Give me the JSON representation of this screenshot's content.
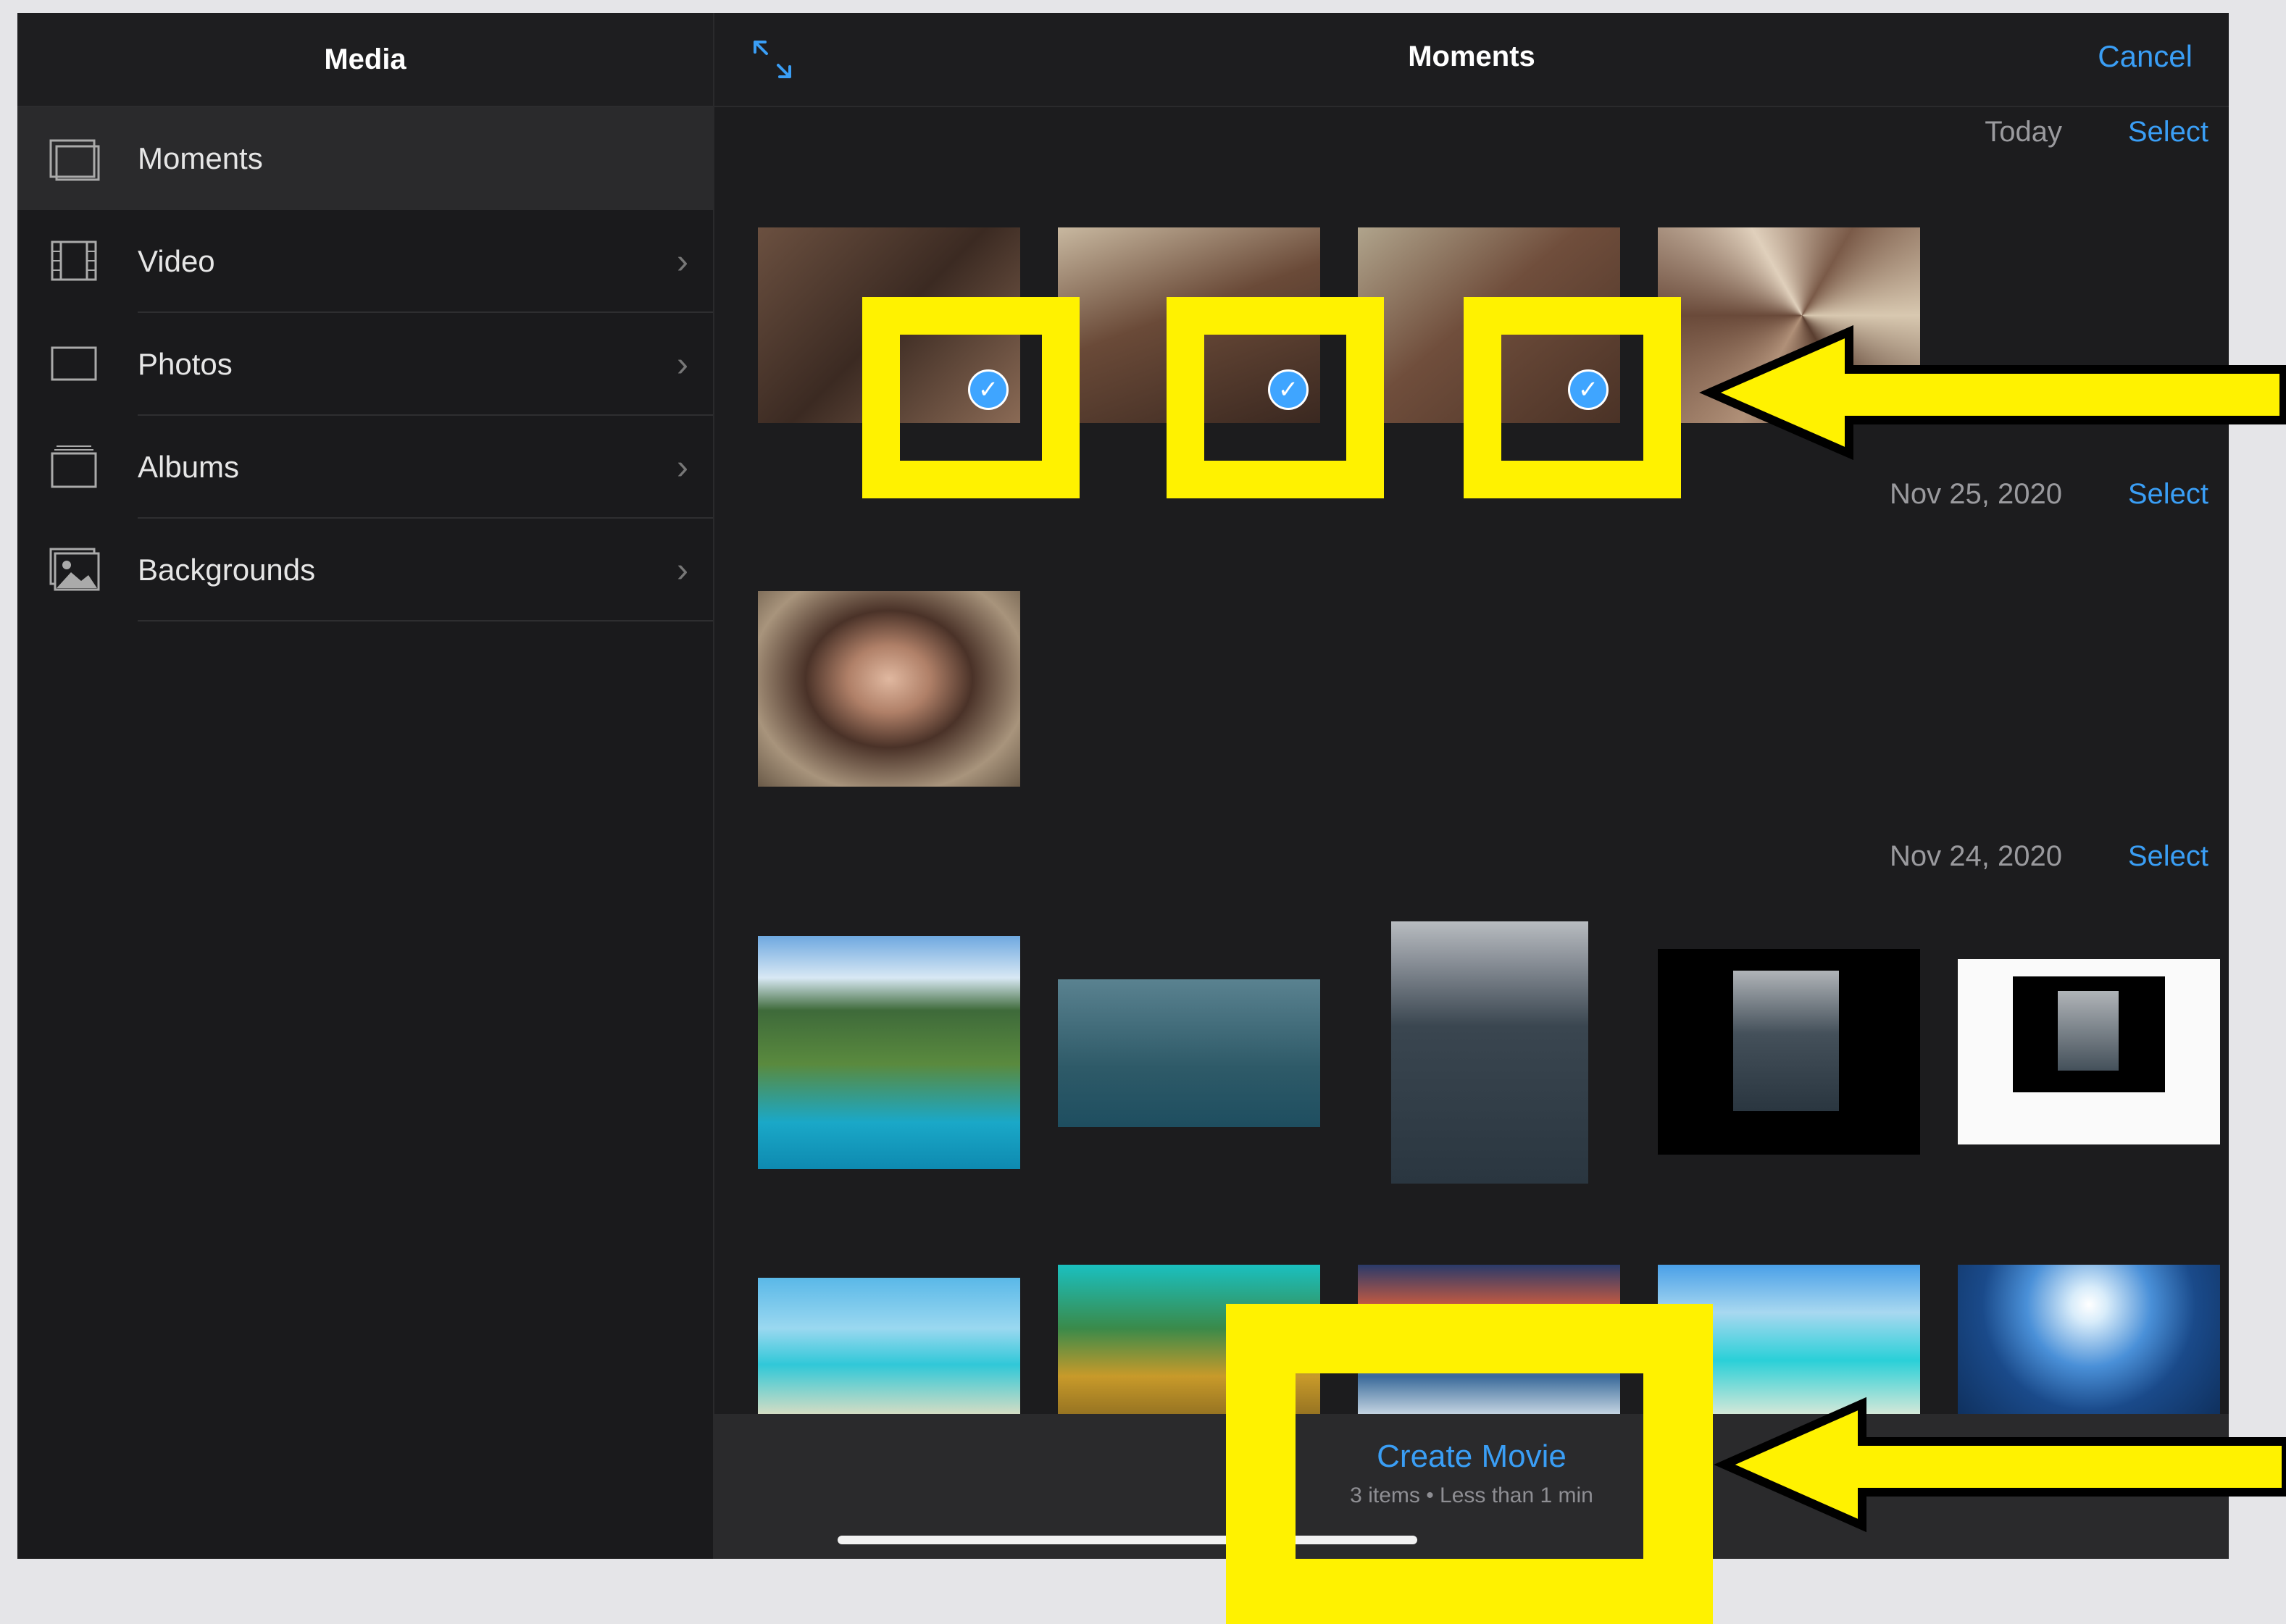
{
  "sidebar": {
    "title": "Media",
    "items": [
      {
        "label": "Moments",
        "icon": "stack-icon",
        "active": true
      },
      {
        "label": "Video",
        "icon": "film-icon"
      },
      {
        "label": "Photos",
        "icon": "photo-frame-icon"
      },
      {
        "label": "Albums",
        "icon": "album-stack-icon"
      },
      {
        "label": "Backgrounds",
        "icon": "landscape-image-icon"
      }
    ]
  },
  "header": {
    "title": "Moments",
    "cancel_label": "Cancel",
    "expand_icon": "expand-arrows-icon"
  },
  "sections": [
    {
      "date": "Today",
      "select_label": "Select"
    },
    {
      "date": "Nov 25, 2020",
      "select_label": "Select"
    },
    {
      "date": "Nov 24, 2020",
      "select_label": "Select"
    }
  ],
  "selection": {
    "checkmark": "✓",
    "selected_count": 3
  },
  "bottom_bar": {
    "create_label": "Create Movie",
    "summary": "3 items • Less than 1 min"
  },
  "colors": {
    "accent": "#3a9ef5",
    "annotation": "#fff200",
    "background": "#1c1c1e"
  }
}
